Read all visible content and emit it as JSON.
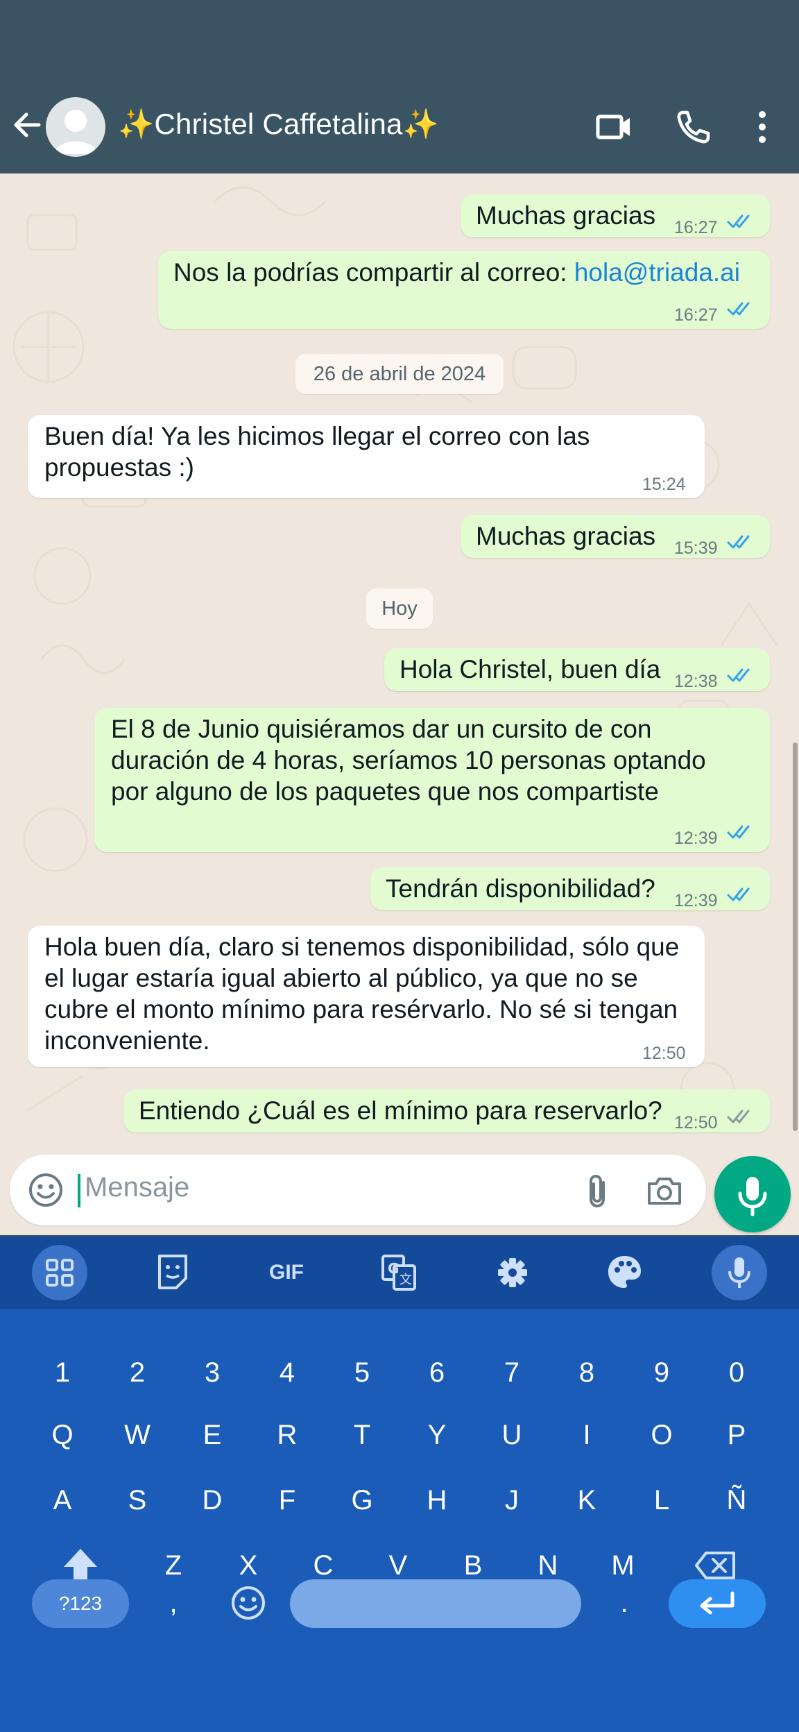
{
  "header": {
    "title": "✨Christel Caffetalina✨",
    "back_icon": "arrow-left-icon",
    "video_icon": "video-call-icon",
    "phone_icon": "phone-call-icon",
    "menu_icon": "more-vert-icon"
  },
  "messages": {
    "m1": {
      "text": "Muchas gracias",
      "time": "16:27",
      "status": "read"
    },
    "m2": {
      "text_prefix": "Nos la podrías compartir al correo: ",
      "link": "hola@triada.ai",
      "time": "16:27",
      "status": "read"
    },
    "date1": "26 de abril de 2024",
    "m3": {
      "text": "Buen día! Ya les hicimos llegar el correo con las\npropuestas :)",
      "time": "15:24"
    },
    "m4": {
      "text": "Muchas gracias",
      "time": "15:39",
      "status": "read"
    },
    "date2": "Hoy",
    "m5": {
      "text": "Hola Christel, buen día",
      "time": "12:38",
      "status": "read"
    },
    "m6": {
      "text": "El 8 de Junio quisiéramos dar un cursito de con\nduración de 4 horas, seríamos 10 personas optando\npor alguno de los paquetes que nos compartiste",
      "time": "12:39",
      "status": "read"
    },
    "m7": {
      "text": "Tendrán disponibilidad?",
      "time": "12:39",
      "status": "read"
    },
    "m8": {
      "text": "Hola buen día, claro si tenemos disponibilidad, sólo que\nel lugar estaría igual abierto al público, ya que no se\ncubre el monto mínimo para resérvarlo. No sé si tengan\ninconveniente.",
      "time": "12:50"
    },
    "m9": {
      "text": "Entiendo ¿Cuál es el mínimo para reservarlo?",
      "time": "12:50",
      "status": "delivered"
    }
  },
  "input": {
    "placeholder": "Mensaje"
  },
  "keyboard": {
    "toolbar": [
      "apps-grid-icon",
      "sticker-icon",
      "GIF",
      "translate-icon",
      "settings-icon",
      "palette-icon",
      "mic-icon"
    ],
    "row_numbers": [
      "1",
      "2",
      "3",
      "4",
      "5",
      "6",
      "7",
      "8",
      "9",
      "0"
    ],
    "row1": [
      "Q",
      "W",
      "E",
      "R",
      "T",
      "Y",
      "U",
      "I",
      "O",
      "P"
    ],
    "row2": [
      "A",
      "S",
      "D",
      "F",
      "G",
      "H",
      "J",
      "K",
      "L",
      "Ñ"
    ],
    "row3": [
      "Z",
      "X",
      "C",
      "V",
      "B",
      "N",
      "M"
    ],
    "symbols_key": "?123",
    "comma": ",",
    "period": "."
  },
  "colors": {
    "header": "#3b5463",
    "outgoing_bubble": "#e2fbd0",
    "incoming_bubble": "#ffffff",
    "read_tick": "#34a3e8",
    "accent": "#00a884",
    "keyboard": "#1a5cb8"
  }
}
